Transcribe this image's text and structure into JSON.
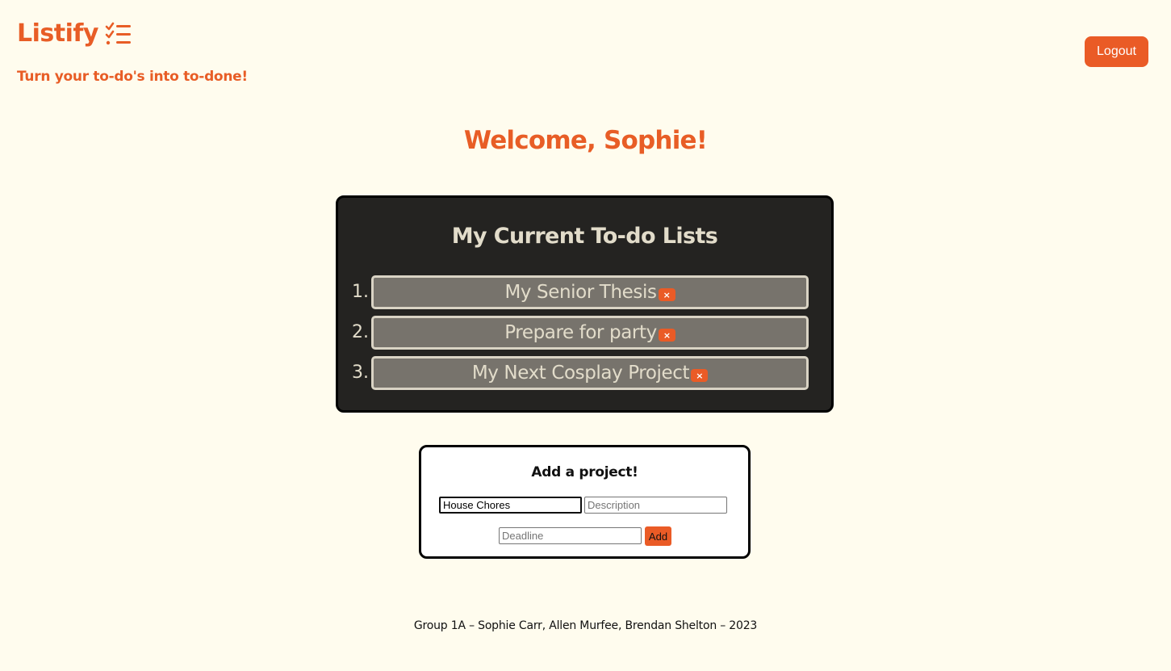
{
  "header": {
    "app_name": "Listify",
    "tagline": "Turn your to-do's into to-done!",
    "logout_label": "Logout",
    "brand_icon": "checklist-icon"
  },
  "welcome": "Welcome, Sophie!",
  "lists": {
    "title": "My Current To-do Lists",
    "items": [
      {
        "number": "1.",
        "name": "My Senior Thesis",
        "delete_label": "×"
      },
      {
        "number": "2.",
        "name": "Prepare for party",
        "delete_label": "×"
      },
      {
        "number": "3.",
        "name": "My Next Cosplay Project",
        "delete_label": "×"
      }
    ]
  },
  "add_project": {
    "title": "Add a project!",
    "name_value": "House Chores",
    "name_placeholder": "",
    "description_value": "",
    "description_placeholder": "Description",
    "deadline_value": "",
    "deadline_placeholder": "Deadline",
    "add_label": "Add"
  },
  "footer": "Group 1A – Sophie Carr, Allen Murfee, Brendan Shelton – 2023",
  "colors": {
    "accent": "#e85d26",
    "background": "#fffcee",
    "panel": "#242321",
    "list_item": "#77736c",
    "list_text": "#e2dcca"
  }
}
